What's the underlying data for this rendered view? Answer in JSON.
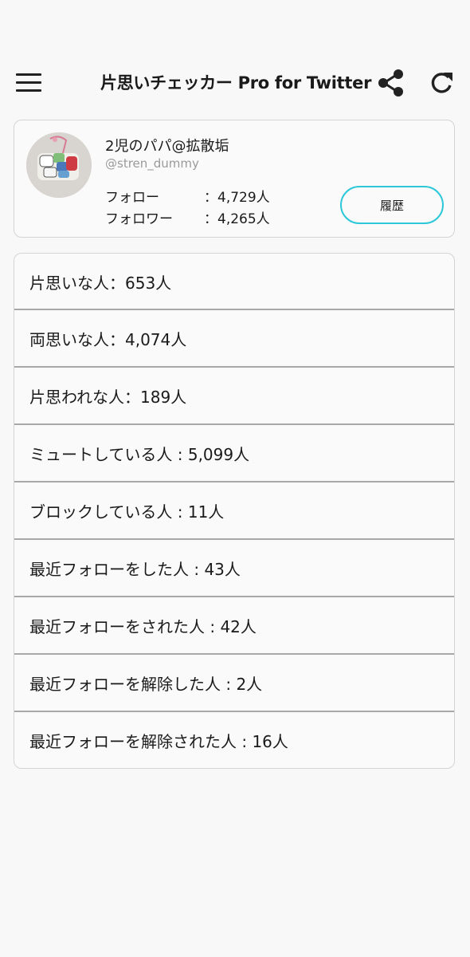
{
  "app": {
    "title": "片思いチェッカー Pro for Twitter",
    "icons": {
      "menu": "hamburger-menu-icon",
      "share": "share-icon",
      "refresh": "refresh-icon"
    }
  },
  "profile": {
    "display_name": "2児のパパ@拡散垢",
    "screen_name": "@stren_dummy",
    "follow_label": "フォロー",
    "follow_value": "：4,729人",
    "follower_label": "フォロワー",
    "follower_value": "：4,265人",
    "history_button": "履歴",
    "accent_color": "#2cc8d8"
  },
  "list": {
    "items": [
      {
        "label": "片思いな人：653人"
      },
      {
        "label": "両思いな人：4,074人"
      },
      {
        "label": "片思われな人：189人"
      },
      {
        "label": "ミュートしている人 : 5,099人"
      },
      {
        "label": "ブロックしている人 : 11人"
      },
      {
        "label": "最近フォローをした人 : 43人"
      },
      {
        "label": "最近フォローをされた人 : 42人"
      },
      {
        "label": "最近フォローを解除した人 : 2人"
      },
      {
        "label": "最近フォローを解除された人 : 16人"
      }
    ]
  }
}
